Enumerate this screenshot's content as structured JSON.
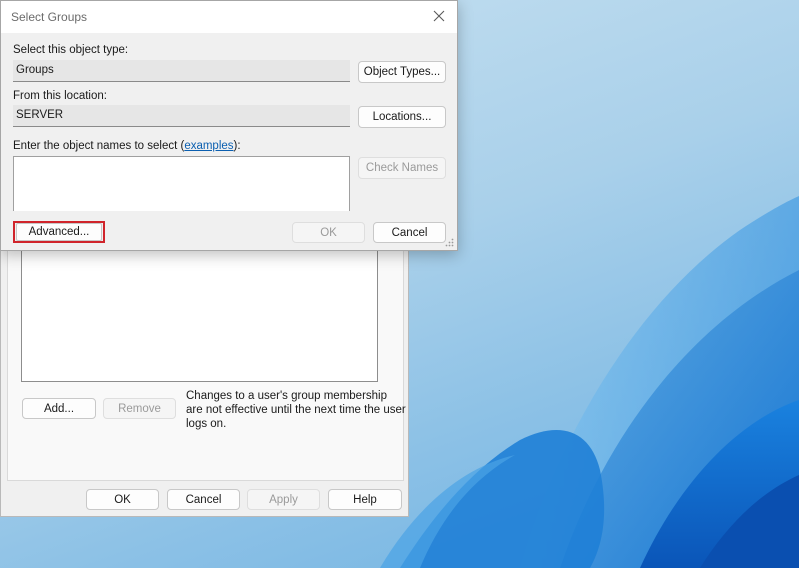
{
  "select_groups": {
    "title": "Select Groups",
    "object_type_label": "Select this object type:",
    "object_type_value": "Groups",
    "object_types_button": "Object Types...",
    "location_label": "From this location:",
    "location_value": "SERVER",
    "locations_button": "Locations...",
    "enter_names_label": "Enter the object names to select (",
    "examples_link": "examples",
    "enter_names_label_end": "):",
    "object_names_value": "",
    "check_names_button": "Check Names",
    "advanced_button": "Advanced...",
    "ok_button": "OK",
    "cancel_button": "Cancel"
  },
  "properties_dialog": {
    "add_button": "Add...",
    "remove_button": "Remove",
    "membership_note": "Changes to a user's group membership are not effective until the next time the user logs on.",
    "ok_button": "OK",
    "cancel_button": "Cancel",
    "apply_button": "Apply",
    "help_button": "Help"
  },
  "colors": {
    "highlight": "#d0242b",
    "link": "#0b5fb0",
    "desktop_accent": "#0a66c8"
  }
}
